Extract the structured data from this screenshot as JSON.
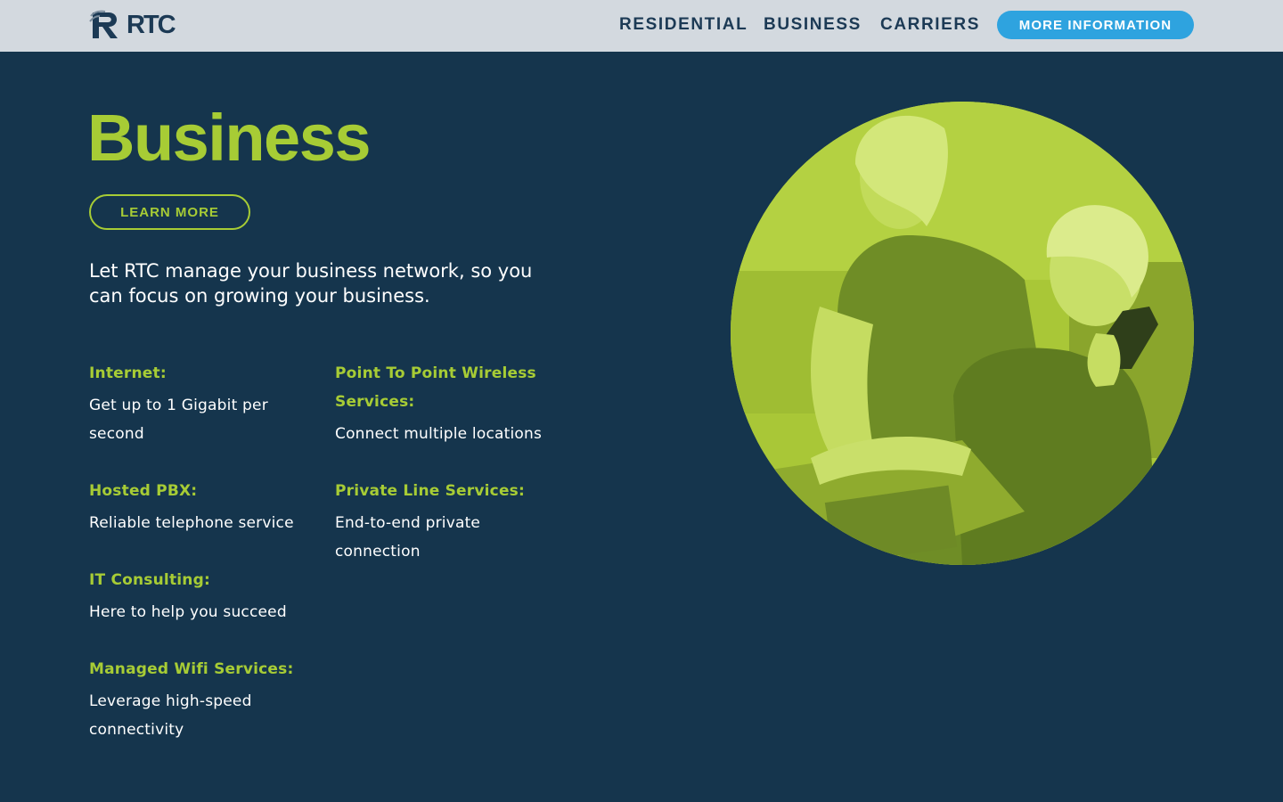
{
  "header": {
    "logo_text": "RTC",
    "nav": [
      {
        "label": "RESIDENTIAL"
      },
      {
        "label": "BUSINESS"
      },
      {
        "label": "CARRIERS"
      }
    ],
    "cta_label": "MORE INFORMATION"
  },
  "hero": {
    "title": "Business",
    "learn_more_label": "LEARN MORE",
    "intro": "Let RTC manage your business network, so you can focus on growing your business."
  },
  "services": [
    {
      "title": "Internet:",
      "description": "Get up to 1 Gigabit per second"
    },
    {
      "title": "Point To Point Wireless Services:",
      "description": "Connect multiple locations"
    },
    {
      "title": "Hosted PBX:",
      "description": "Reliable telephone service"
    },
    {
      "title": "Private Line Services:",
      "description": "End-to-end private connection"
    },
    {
      "title": "IT Consulting:",
      "description": "Here to help you succeed"
    },
    {
      "title": "Managed Wifi Services:",
      "description": "Leverage high-speed connectivity"
    }
  ],
  "colors": {
    "background": "#15354d",
    "header_bg": "#d3d9df",
    "accent_green": "#a7cc35",
    "cta_blue": "#2ea3df",
    "nav_text": "#1c3a55"
  }
}
